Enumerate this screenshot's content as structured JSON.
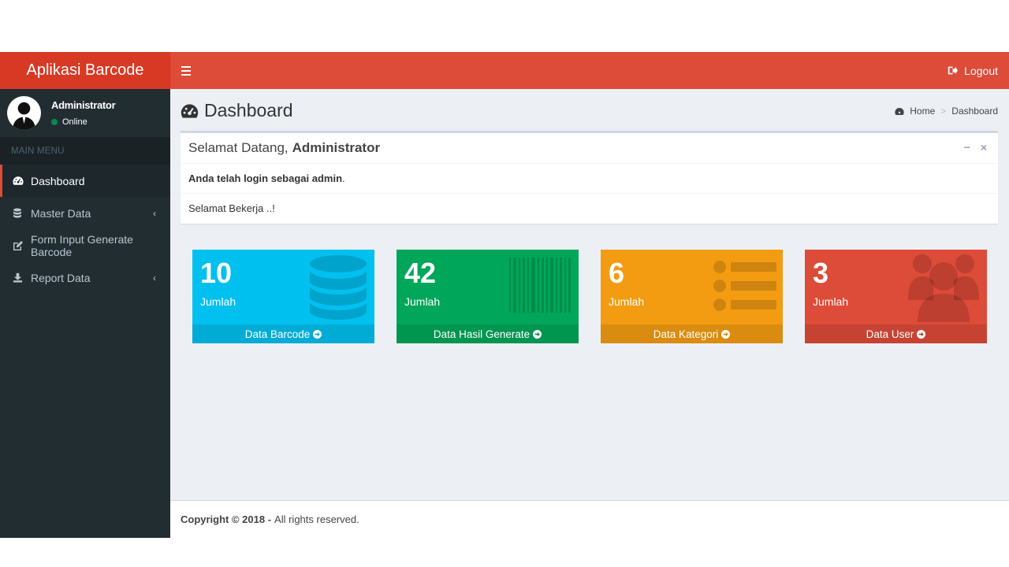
{
  "header": {
    "logo": "Aplikasi Barcode",
    "logout_label": "Logout"
  },
  "user": {
    "name": "Administrator",
    "status": "Online"
  },
  "sidebar": {
    "menu_header": "MAIN MENU",
    "items": [
      {
        "label": "Dashboard",
        "icon": "dashboard-icon",
        "active": true
      },
      {
        "label": "Master Data",
        "icon": "database-icon",
        "has_submenu": true
      },
      {
        "label": "Form Input Generate Barcode",
        "icon": "edit-icon"
      },
      {
        "label": "Report Data",
        "icon": "download-icon",
        "has_submenu": true
      }
    ],
    "chevron": "‹"
  },
  "page": {
    "title": "Dashboard",
    "breadcrumb": [
      "Home",
      "Dashboard"
    ],
    "breadcrumb_sep": ">"
  },
  "welcome_box": {
    "title_prefix": "Selamat Datang,",
    "title_name": "Administrator",
    "line1_bold": "Anda telah login sebagai admin",
    "line1_end": ".",
    "line2": "Selamat Bekerja ..!",
    "minimize": "−",
    "close": "×"
  },
  "stats": [
    {
      "value": "10",
      "label": "Jumlah",
      "footer": "Data Barcode",
      "color": "#00c0ef",
      "icon": "database-icon"
    },
    {
      "value": "42",
      "label": "Jumlah",
      "footer": "Data Hasil Generate",
      "color": "#00a65a",
      "icon": "barcode-icon"
    },
    {
      "value": "6",
      "label": "Jumlah",
      "footer": "Data Kategori",
      "color": "#f39c12",
      "icon": "list-icon"
    },
    {
      "value": "3",
      "label": "Jumlah",
      "footer": "Data User",
      "color": "#dd4b39",
      "icon": "users-icon"
    }
  ],
  "footer": {
    "copyright": "Copyright © 2018 -",
    "rights": "All rights reserved."
  }
}
